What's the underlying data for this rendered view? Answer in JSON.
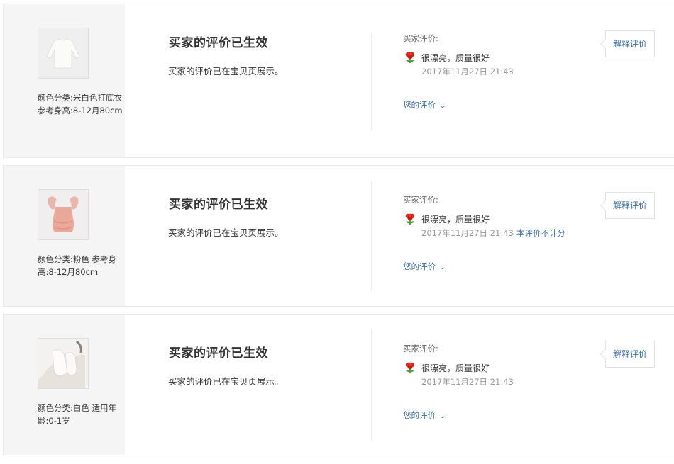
{
  "reviews": [
    {
      "sku": "颜色分类:米白色打底衣  参考身高:8-12月80cm",
      "product_image": "white-long-sleeve-top",
      "status_title": "买家的评价已生效",
      "status_desc": "买家的评价已在宝贝页展示。",
      "review_label": "买家评价:",
      "review_icon": "red-flower-icon",
      "review_text": "很漂亮，质量很好",
      "review_time": "2017年11月27日 21:43",
      "not_counted": "",
      "your_review": "您的评价",
      "explain_button": "解释评价"
    },
    {
      "sku": "颜色分类:粉色  参考身高:8-12月80cm",
      "product_image": "pink-ruffle-romper",
      "status_title": "买家的评价已生效",
      "status_desc": "买家的评价已在宝贝页展示。",
      "review_label": "买家评价:",
      "review_icon": "red-flower-icon",
      "review_text": "很漂亮，质量很好",
      "review_time": "2017年11月27日 21:43",
      "not_counted": "本评价不计分",
      "your_review": "您的评价",
      "explain_button": "解释评价"
    },
    {
      "sku": "颜色分类:白色  适用年龄:0-1岁",
      "product_image": "white-baby-socks",
      "status_title": "买家的评价已生效",
      "status_desc": "买家的评价已在宝贝页展示。",
      "review_label": "买家评价:",
      "review_icon": "red-flower-icon",
      "review_text": "很漂亮，质量很好",
      "review_time": "2017年11月27日 21:43",
      "not_counted": "",
      "your_review": "您的评价",
      "explain_button": "解释评价"
    }
  ],
  "colors": {
    "link": "#3d6e9e",
    "muted": "#999999",
    "panel": "#f5f5f5"
  }
}
